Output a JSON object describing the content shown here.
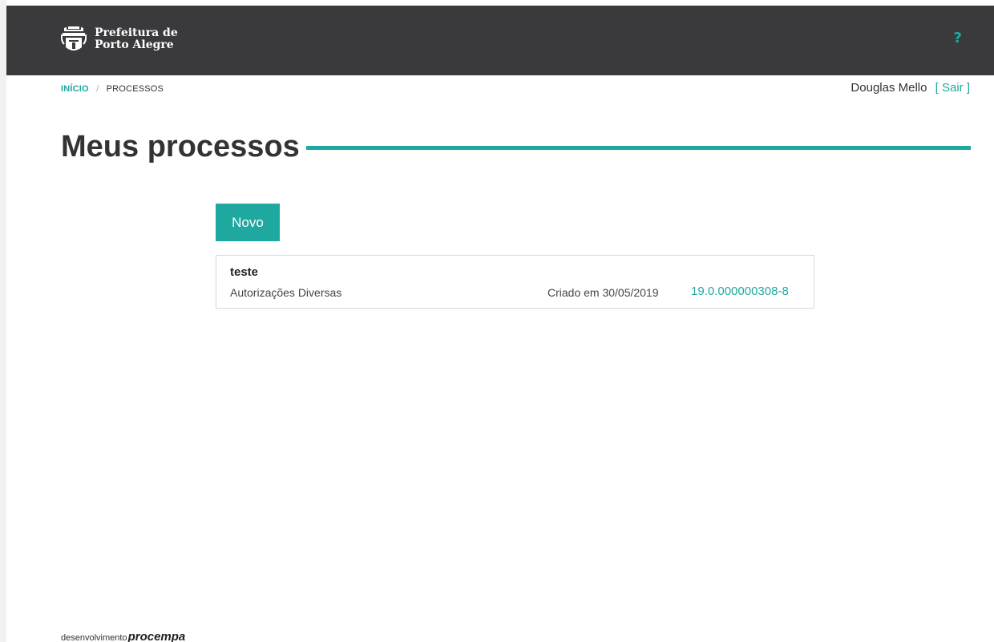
{
  "header": {
    "logo_line1": "Prefeitura de",
    "logo_line2": "Porto Alegre",
    "help_label": "?"
  },
  "breadcrumb": {
    "home": "INÍCIO",
    "separator": "/",
    "current": "PROCESSOS"
  },
  "user": {
    "name": "Douglas Mello",
    "logout_label": "[ Sair ]"
  },
  "page": {
    "title": "Meus processos"
  },
  "actions": {
    "new_label": "Novo"
  },
  "processes": [
    {
      "title": "teste",
      "category": "Autorizações Diversas",
      "created": "Criado em 30/05/2019",
      "number": "19.0.000000308-8"
    }
  ],
  "footer": {
    "prefix": "desenvolvimento",
    "brand": "procempa"
  },
  "colors": {
    "accent": "#1fa8a0",
    "header_bg": "#3a3a3d"
  },
  "icons": {
    "logo": "city-crest-icon",
    "help": "question-mark-icon"
  }
}
